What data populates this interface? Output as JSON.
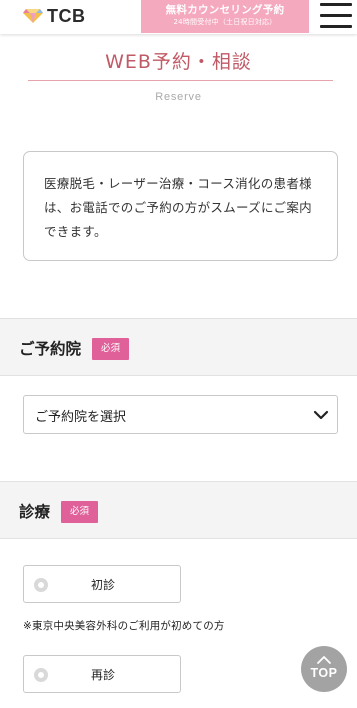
{
  "header": {
    "logo_text": "TCB",
    "cta_main": "無料カウンセリング予約",
    "cta_sub": "24時間受付中（土日祝日対応）",
    "menu_icon": "hamburger-menu-icon"
  },
  "page": {
    "title": "WEB予約・相談",
    "subtitle": "Reserve"
  },
  "notice": {
    "text": "医療脱毛・レーザー治療・コース消化の患者様は、お電話でのご予約の方がスムーズにご案内できます。"
  },
  "sections": {
    "clinic": {
      "title": "ご予約院",
      "badge": "必須",
      "select_value": "ご予約院を選択"
    },
    "visit": {
      "title": "診療",
      "badge": "必須",
      "option_first": "初診",
      "option_first_note": "※東京中央美容外科のご利用が初めての方",
      "option_return": "再診"
    }
  },
  "top_button": {
    "label": "TOP"
  },
  "colors": {
    "title": "#c05a66",
    "badge": "#e0609a",
    "cta": "#f5a9bf",
    "section_bg": "#f4f4f4"
  }
}
